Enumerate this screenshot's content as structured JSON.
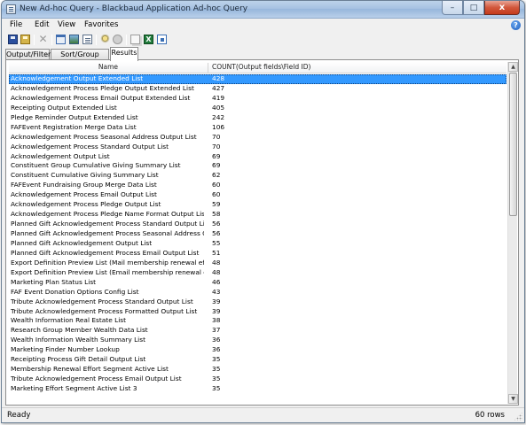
{
  "window": {
    "title": "New Ad-hoc Query - Blackbaud Application Ad-hoc Query",
    "min_glyph": "–",
    "max_glyph": "□",
    "close_glyph": "x"
  },
  "menu": {
    "items": [
      "File",
      "Edit",
      "View",
      "Favorites"
    ],
    "help_glyph": "?"
  },
  "toolbar": {
    "icons": [
      "save-icon",
      "save-as-icon",
      "delete-icon",
      "properties-icon",
      "image-icon",
      "report-icon",
      "tools-icon",
      "schedule-icon",
      "copy-icon",
      "excel-icon",
      "export-icon"
    ],
    "excel_glyph": "X"
  },
  "tabs": [
    {
      "label": "Output/Filters",
      "active": false
    },
    {
      "label": "Sort/Group Filters",
      "active": false
    },
    {
      "label": "Results",
      "active": true
    }
  ],
  "results": {
    "columns": [
      "Name",
      "COUNT(Output fields\\Field ID)"
    ],
    "rows": [
      {
        "name": "Acknowledgement Output Extended List",
        "count": "428",
        "selected": true
      },
      {
        "name": "Acknowledgement Process Pledge Output Extended List",
        "count": "427"
      },
      {
        "name": "Acknowledgement Process Email Output Extended List",
        "count": "419"
      },
      {
        "name": "Receipting Output Extended List",
        "count": "405"
      },
      {
        "name": "Pledge Reminder Output Extended List",
        "count": "242"
      },
      {
        "name": "FAFEvent Registration Merge Data List",
        "count": "106"
      },
      {
        "name": "Acknowledgement Process Seasonal Address Output List",
        "count": "70"
      },
      {
        "name": "Acknowledgement Process Standard Output List",
        "count": "70"
      },
      {
        "name": "Acknowledgement Output List",
        "count": "69"
      },
      {
        "name": "Constituent Group Cumulative Giving Summary List",
        "count": "69"
      },
      {
        "name": "Constituent Cumulative Giving Summary List",
        "count": "62"
      },
      {
        "name": "FAFEvent Fundraising Group Merge Data List",
        "count": "60"
      },
      {
        "name": "Acknowledgement Process Email Output List",
        "count": "60"
      },
      {
        "name": "Acknowledgement Process Pledge Output List",
        "count": "59"
      },
      {
        "name": "Acknowledgement Process Pledge Name Format Output List",
        "count": "58"
      },
      {
        "name": "Planned Gift Acknowledgement Process Standard Output List",
        "count": "56"
      },
      {
        "name": "Planned Gift Acknowledgement Process Seasonal Address Output",
        "count": "56"
      },
      {
        "name": "Planned Gift Acknowledgement Output List",
        "count": "55"
      },
      {
        "name": "Planned Gift Acknowledgement Process Email Output List",
        "count": "51"
      },
      {
        "name": "Export Definition Preview List (Mail membership renewal effo",
        "count": "48"
      },
      {
        "name": "Export Definition Preview List (Email membership renewal eff",
        "count": "48"
      },
      {
        "name": "Marketing Plan Status List",
        "count": "46"
      },
      {
        "name": "FAF Event Donation Options Config List",
        "count": "43"
      },
      {
        "name": "Tribute Acknowledgement Process Standard Output List",
        "count": "39"
      },
      {
        "name": "Tribute Acknowledgement Process Formatted Output List",
        "count": "39"
      },
      {
        "name": "Wealth Information Real Estate List",
        "count": "38"
      },
      {
        "name": "Research Group Member Wealth Data List",
        "count": "37"
      },
      {
        "name": "Wealth Information Wealth Summary List",
        "count": "36"
      },
      {
        "name": "Marketing Finder Number Lookup",
        "count": "36"
      },
      {
        "name": "Receipting Process Gift Detail Output List",
        "count": "35"
      },
      {
        "name": "Membership Renewal Effort Segment Active List",
        "count": "35"
      },
      {
        "name": "Tribute Acknowledgement Process Email Output List",
        "count": "35"
      },
      {
        "name": "Marketing Effort Segment Active List 3",
        "count": "35"
      }
    ]
  },
  "scrollbar": {
    "up_glyph": "▲",
    "down_glyph": "▼"
  },
  "status": {
    "left": "Ready",
    "right": "60 rows"
  }
}
